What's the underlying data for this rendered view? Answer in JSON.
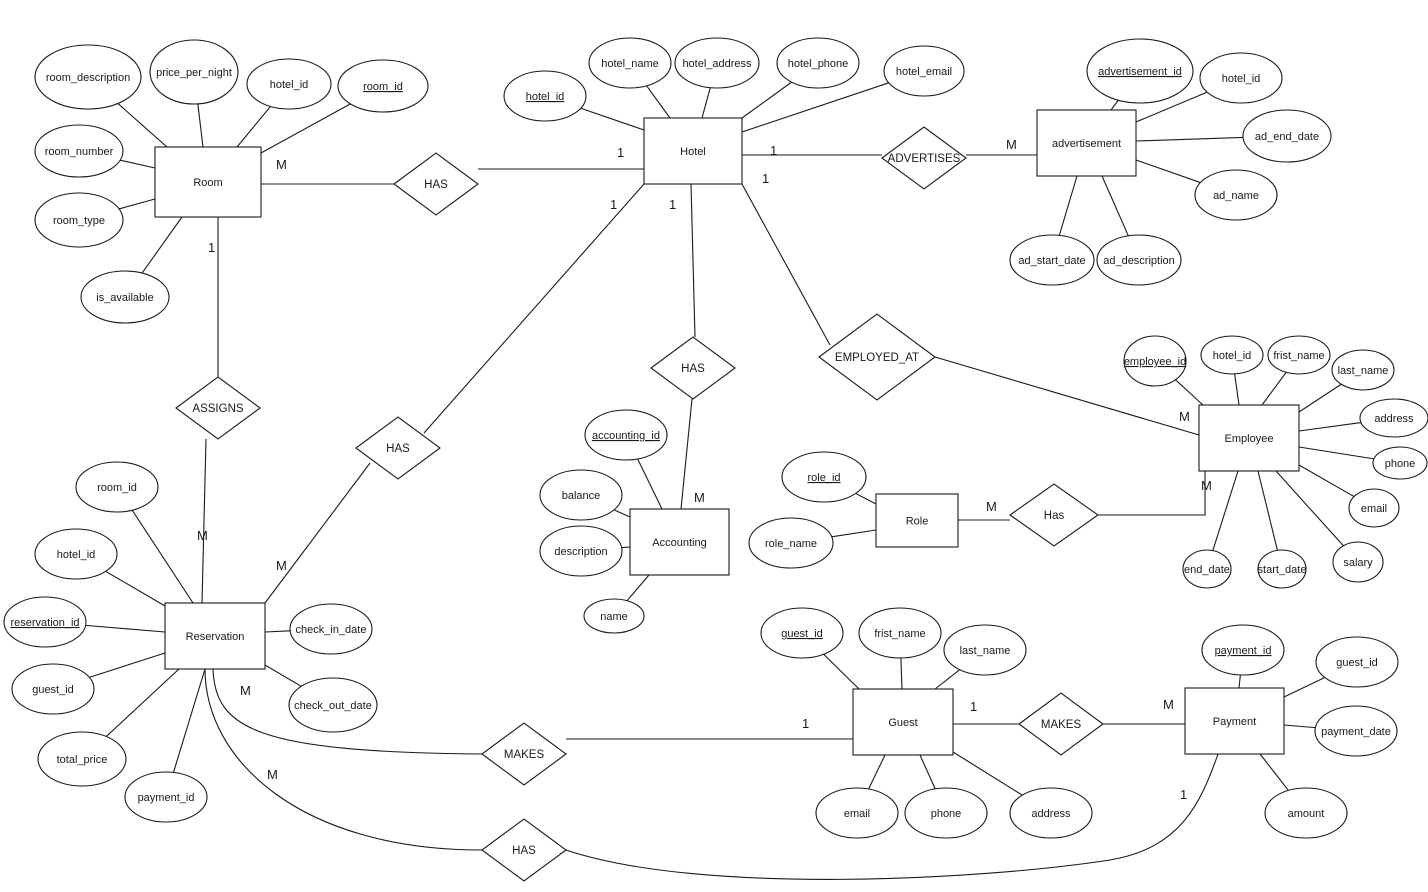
{
  "diagram": {
    "type": "entity-relationship",
    "entities": [
      {
        "id": "room",
        "label": "Room"
      },
      {
        "id": "hotel",
        "label": "Hotel"
      },
      {
        "id": "advertisement",
        "label": "advertisement"
      },
      {
        "id": "accounting",
        "label": "Accounting"
      },
      {
        "id": "employee",
        "label": "Employee"
      },
      {
        "id": "role",
        "label": "Role"
      },
      {
        "id": "reservation",
        "label": "Reservation"
      },
      {
        "id": "guest",
        "label": "Guest"
      },
      {
        "id": "payment",
        "label": "Payment"
      }
    ],
    "attributes": [
      {
        "entity": "room",
        "label": "room_description",
        "key": false
      },
      {
        "entity": "room",
        "label": "price_per_night",
        "key": false
      },
      {
        "entity": "room",
        "label": "hotel_id",
        "key": false
      },
      {
        "entity": "room",
        "label": "room_id",
        "key": true
      },
      {
        "entity": "room",
        "label": "room_number",
        "key": false
      },
      {
        "entity": "room",
        "label": "room_type",
        "key": false
      },
      {
        "entity": "room",
        "label": "is_available",
        "key": false
      },
      {
        "entity": "hotel",
        "label": "hotel_id",
        "key": true
      },
      {
        "entity": "hotel",
        "label": "hotel_name",
        "key": false
      },
      {
        "entity": "hotel",
        "label": "hotel_address",
        "key": false
      },
      {
        "entity": "hotel",
        "label": "hotel_phone",
        "key": false
      },
      {
        "entity": "hotel",
        "label": "hotel_email",
        "key": false
      },
      {
        "entity": "advertisement",
        "label": "advertisement_id",
        "key": true
      },
      {
        "entity": "advertisement",
        "label": "hotel_id",
        "key": false
      },
      {
        "entity": "advertisement",
        "label": "ad_end_date",
        "key": false
      },
      {
        "entity": "advertisement",
        "label": "ad_name",
        "key": false
      },
      {
        "entity": "advertisement",
        "label": "ad_start_date",
        "key": false
      },
      {
        "entity": "advertisement",
        "label": "ad_description",
        "key": false
      },
      {
        "entity": "accounting",
        "label": "accounting_id",
        "key": true
      },
      {
        "entity": "accounting",
        "label": "balance",
        "key": false
      },
      {
        "entity": "accounting",
        "label": "description",
        "key": false
      },
      {
        "entity": "accounting",
        "label": "name",
        "key": false
      },
      {
        "entity": "employee",
        "label": "employee_id",
        "key": true
      },
      {
        "entity": "employee",
        "label": "hotel_id",
        "key": false
      },
      {
        "entity": "employee",
        "label": "frist_name",
        "key": false
      },
      {
        "entity": "employee",
        "label": "last_name",
        "key": false
      },
      {
        "entity": "employee",
        "label": "address",
        "key": false
      },
      {
        "entity": "employee",
        "label": "phone",
        "key": false
      },
      {
        "entity": "employee",
        "label": "email",
        "key": false
      },
      {
        "entity": "employee",
        "label": "salary",
        "key": false
      },
      {
        "entity": "employee",
        "label": "start_date",
        "key": false
      },
      {
        "entity": "employee",
        "label": "end_date",
        "key": false
      },
      {
        "entity": "role",
        "label": "role_id",
        "key": true
      },
      {
        "entity": "role",
        "label": "role_name",
        "key": false
      },
      {
        "entity": "reservation",
        "label": "room_id",
        "key": false
      },
      {
        "entity": "reservation",
        "label": "hotel_id",
        "key": false
      },
      {
        "entity": "reservation",
        "label": "reservation_id",
        "key": true
      },
      {
        "entity": "reservation",
        "label": "guest_id",
        "key": false
      },
      {
        "entity": "reservation",
        "label": "total_price",
        "key": false
      },
      {
        "entity": "reservation",
        "label": "payment_id",
        "key": false
      },
      {
        "entity": "reservation",
        "label": "check_in_date",
        "key": false
      },
      {
        "entity": "reservation",
        "label": "check_out_date",
        "key": false
      },
      {
        "entity": "guest",
        "label": "guest_id",
        "key": true
      },
      {
        "entity": "guest",
        "label": "frist_name",
        "key": false
      },
      {
        "entity": "guest",
        "label": "last_name",
        "key": false
      },
      {
        "entity": "guest",
        "label": "email",
        "key": false
      },
      {
        "entity": "guest",
        "label": "phone",
        "key": false
      },
      {
        "entity": "guest",
        "label": "address",
        "key": false
      },
      {
        "entity": "payment",
        "label": "payment_id",
        "key": true
      },
      {
        "entity": "payment",
        "label": "guest_id",
        "key": false
      },
      {
        "entity": "payment",
        "label": "payment_date",
        "key": false
      },
      {
        "entity": "payment",
        "label": "amount",
        "key": false
      }
    ],
    "relationships": [
      {
        "id": "room_has_hotel",
        "label": "HAS",
        "from": "room",
        "from_card": "M",
        "to": "hotel",
        "to_card": "1"
      },
      {
        "id": "hotel_advertises",
        "label": "ADVERTISES",
        "from": "hotel",
        "from_card": "1",
        "to": "advertisement",
        "to_card": "M"
      },
      {
        "id": "hotel_has_accounting",
        "label": "HAS",
        "from": "hotel",
        "from_card": "1",
        "to": "accounting",
        "to_card": "M"
      },
      {
        "id": "employed_at",
        "label": "EMPLOYED_AT",
        "from": "hotel",
        "from_card": "1",
        "to": "employee",
        "to_card": "M"
      },
      {
        "id": "room_assigns",
        "label": "ASSIGNS",
        "from": "room",
        "from_card": "1",
        "to": "reservation",
        "to_card": "M"
      },
      {
        "id": "hotel_has_reservation",
        "label": "HAS",
        "from": "hotel",
        "from_card": "1",
        "to": "reservation",
        "to_card": "M"
      },
      {
        "id": "role_has_employee",
        "label": "Has",
        "from": "role",
        "from_card": "M",
        "to": "employee",
        "to_card": "M"
      },
      {
        "id": "guest_makes_reservation",
        "label": "MAKES",
        "from": "reservation",
        "from_card": "M",
        "to": "guest",
        "to_card": "1"
      },
      {
        "id": "guest_makes_payment",
        "label": "MAKES",
        "from": "guest",
        "from_card": "1",
        "to": "payment",
        "to_card": "M"
      },
      {
        "id": "reservation_has_payment",
        "label": "HAS",
        "from": "reservation",
        "from_card": "M",
        "to": "payment",
        "to_card": "1"
      }
    ]
  }
}
